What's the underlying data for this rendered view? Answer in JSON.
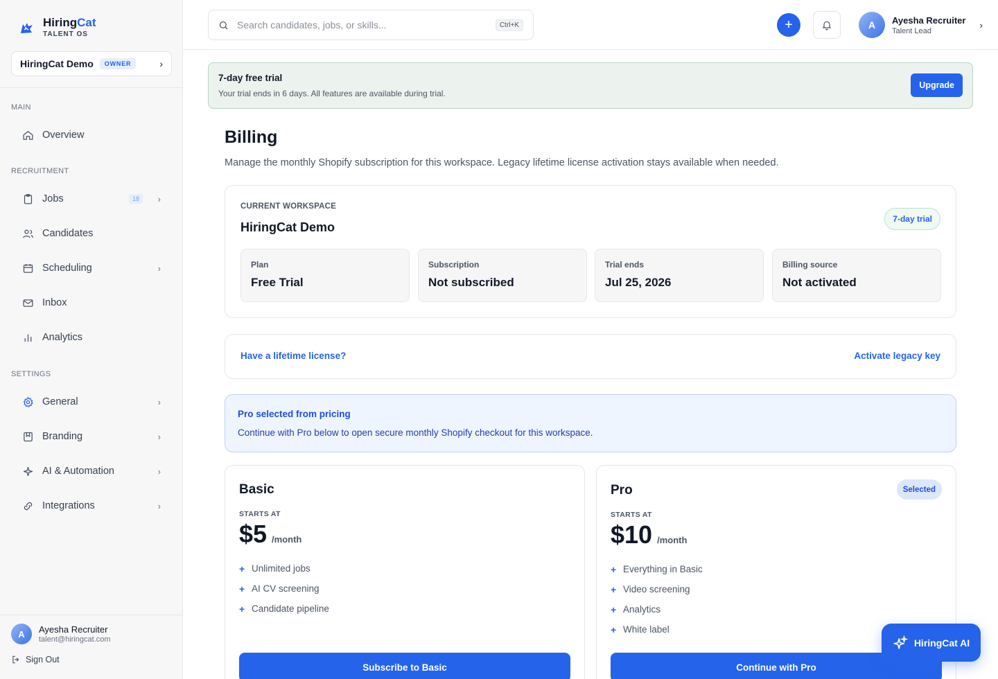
{
  "brand": {
    "name_part1": "Hiring",
    "name_part2": "Cat",
    "subtitle": "TALENT OS"
  },
  "workspace_switcher": {
    "name": "HiringCat Demo",
    "badge": "OWNER"
  },
  "sidebar": {
    "sections": {
      "main": "MAIN",
      "recruitment": "RECRUITMENT",
      "settings": "SETTINGS"
    },
    "items": [
      {
        "label": "Overview",
        "icon": "home-icon"
      },
      {
        "label": "Jobs",
        "icon": "clipboard-icon",
        "count": "18"
      },
      {
        "label": "Candidates",
        "icon": "users-icon"
      },
      {
        "label": "Scheduling",
        "icon": "calendar-icon"
      },
      {
        "label": "Inbox",
        "icon": "mail-icon"
      },
      {
        "label": "Analytics",
        "icon": "bar-chart-icon"
      },
      {
        "label": "General",
        "icon": "gear-icon"
      },
      {
        "label": "Branding",
        "icon": "branding-icon"
      },
      {
        "label": "AI & Automation",
        "icon": "sparkle-icon"
      },
      {
        "label": "Integrations",
        "icon": "link-icon"
      }
    ],
    "user": {
      "initial": "A",
      "name": "Ayesha Recruiter",
      "email": "talent@hiringcat.com"
    },
    "sign_out": "Sign Out"
  },
  "topbar": {
    "search_placeholder": "Search candidates, jobs, or skills...",
    "shortcut": "Ctrl+K",
    "add_label": "+",
    "profile": {
      "initial": "A",
      "name": "Ayesha Recruiter",
      "role": "Talent Lead"
    }
  },
  "trial_banner": {
    "title": "7-day free trial",
    "text": "Your trial ends in 6 days. All features are available during trial.",
    "button": "Upgrade"
  },
  "page": {
    "title": "Billing",
    "subtitle": "Manage the monthly Shopify subscription for this workspace. Legacy lifetime license activation stays available when needed."
  },
  "workspace_card": {
    "label": "CURRENT WORKSPACE",
    "name": "HiringCat Demo",
    "pill": "7-day trial",
    "stats": [
      {
        "label": "Plan",
        "value": "Free Trial"
      },
      {
        "label": "Subscription",
        "value": "Not subscribed"
      },
      {
        "label": "Trial ends",
        "value": "Jul 25, 2026"
      },
      {
        "label": "Billing source",
        "value": "Not activated"
      }
    ]
  },
  "license": {
    "question": "Have a lifetime license?",
    "action": "Activate legacy key"
  },
  "pro_note": {
    "title": "Pro selected from pricing",
    "text": "Continue with Pro below to open secure monthly Shopify checkout for this workspace."
  },
  "plans": [
    {
      "name": "Basic",
      "starts_at": "STARTS AT",
      "price": "$5",
      "period": "/month",
      "features": [
        "Unlimited jobs",
        "AI CV screening",
        "Candidate pipeline"
      ],
      "button": "Subscribe to Basic"
    },
    {
      "name": "Pro",
      "starts_at": "STARTS AT",
      "price": "$10",
      "period": "/month",
      "badge": "Selected",
      "features": [
        "Everything in Basic",
        "Video screening",
        "Analytics",
        "White label"
      ],
      "button": "Continue with Pro"
    }
  ],
  "ai_button": {
    "label": "HiringCat AI"
  },
  "colors": {
    "accent": "#2563eb",
    "trial_bg": "#ecf3ee",
    "note_bg": "#eff5fe"
  }
}
